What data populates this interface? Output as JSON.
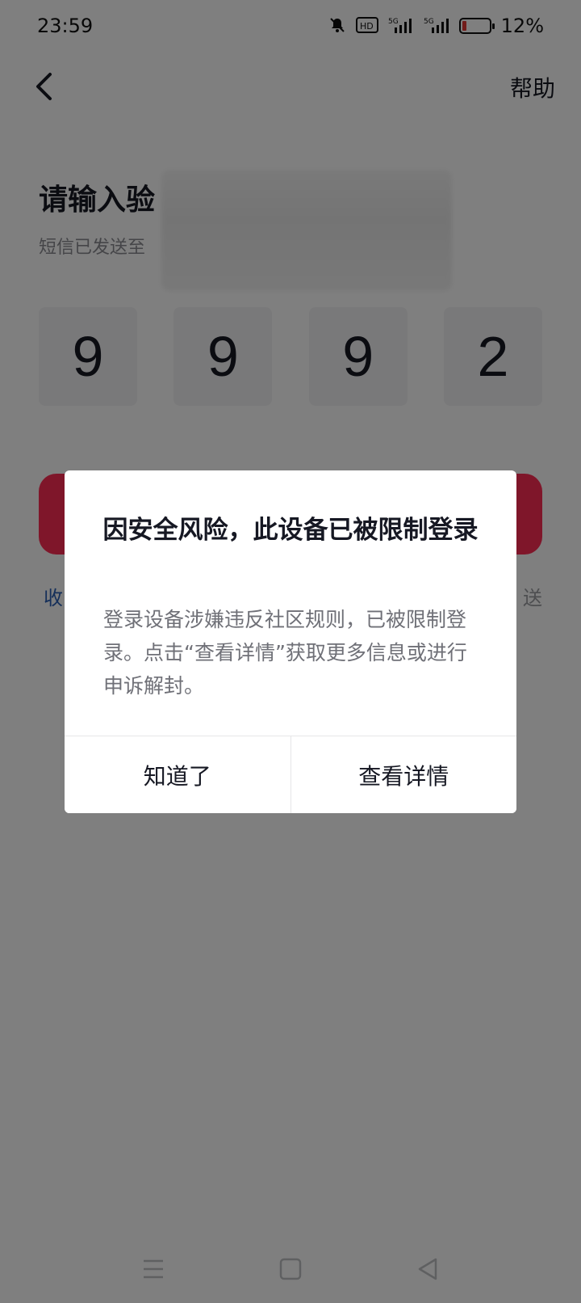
{
  "status_bar": {
    "time": "23:59",
    "battery_text": "12%",
    "icons": [
      "bell-muted-icon",
      "hd-icon",
      "signal-5g-icon",
      "signal-5g-icon",
      "battery-icon"
    ]
  },
  "header": {
    "back_icon": "chevron-left-icon",
    "help_label": "帮助"
  },
  "page": {
    "title_visible": "请输入验",
    "subtitle_visible": "短信已发送至"
  },
  "code": {
    "digits": [
      "9",
      "9",
      "9",
      "2"
    ]
  },
  "links": {
    "left_visible": "收",
    "right_visible": "送"
  },
  "dialog": {
    "title": "因安全风险，此设备已被限制登录",
    "body": "登录设备涉嫌违反社区规则，已被限制登录。点击“查看详情”获取更多信息或进行申诉解封。",
    "btn_dismiss": "知道了",
    "btn_details": "查看详情"
  },
  "nav": {
    "icons": [
      "menu-icon",
      "home-square-icon",
      "back-triangle-icon"
    ]
  },
  "colors": {
    "accent": "#fe2c55",
    "link": "#2b5fb4",
    "overlay": "rgba(0,0,0,0.5)"
  }
}
